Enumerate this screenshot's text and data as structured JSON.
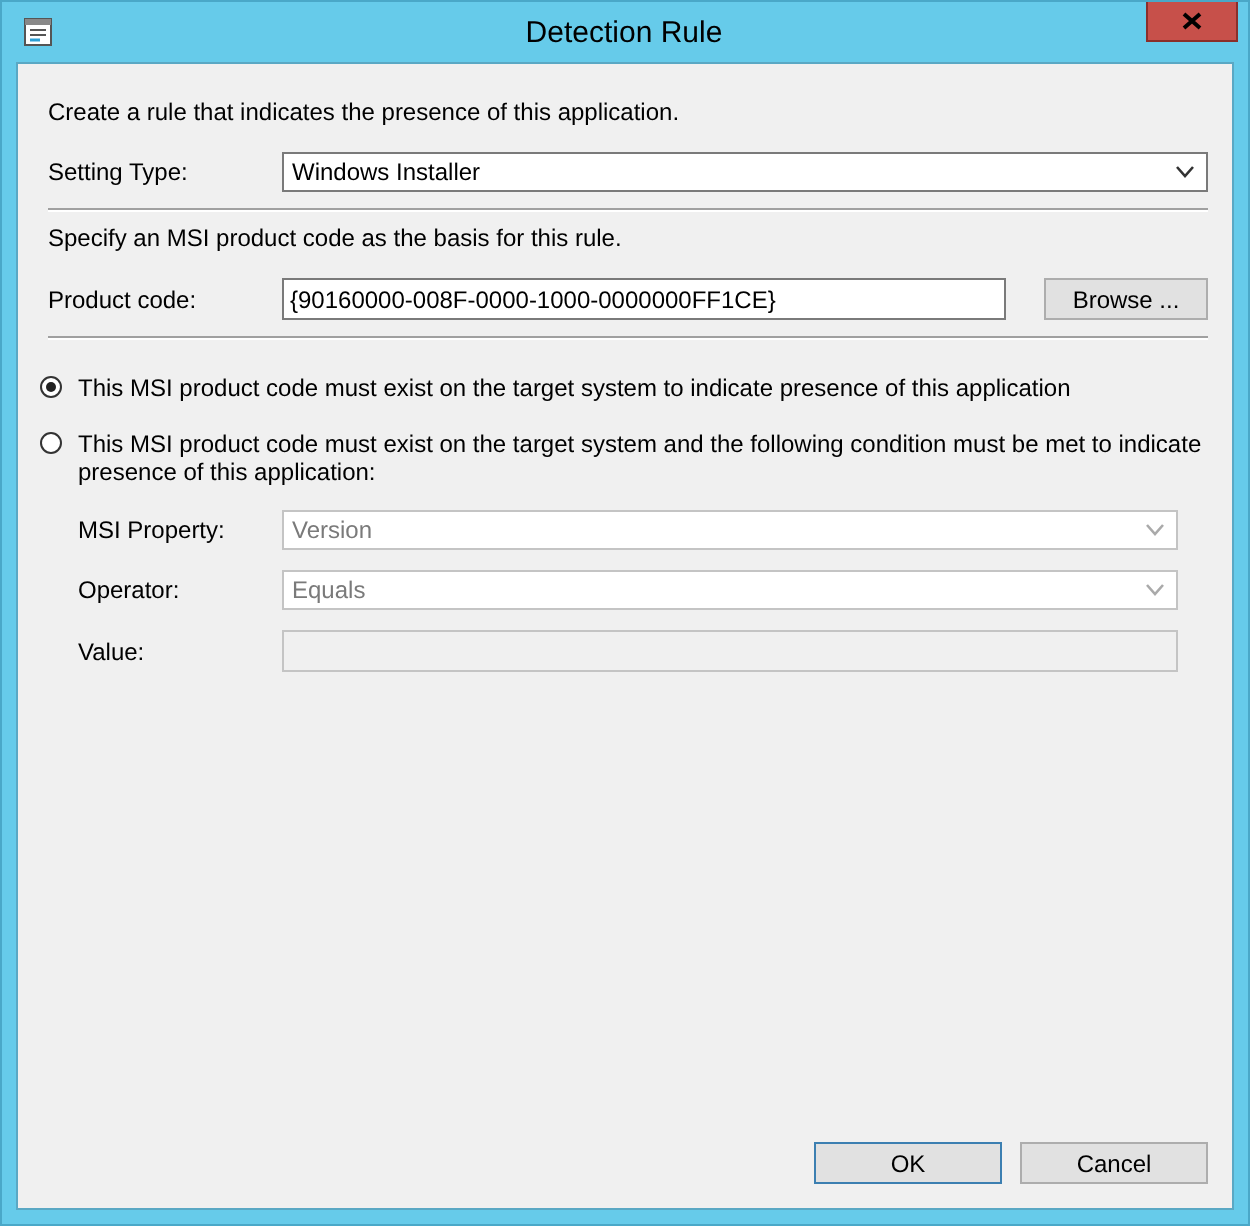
{
  "window": {
    "title": "Detection Rule"
  },
  "intro": "Create a rule that indicates the presence of this application.",
  "setting_type": {
    "label": "Setting Type:",
    "value": "Windows Installer"
  },
  "instruction": "Specify an MSI product code as the basis for this rule.",
  "product_code": {
    "label": "Product code:",
    "value": "{90160000-008F-0000-1000-0000000FF1CE}"
  },
  "browse_button": "Browse ...",
  "options": [
    {
      "label": "This MSI product code must exist on the target system to indicate presence of this application",
      "selected": true
    },
    {
      "label": "This MSI product code must exist on the target system and the following condition must be met to indicate presence of this application:",
      "selected": false
    }
  ],
  "condition": {
    "disabled": true,
    "fields": [
      {
        "kind": "dropdown",
        "label": "MSI Property:",
        "value": "Version"
      },
      {
        "kind": "dropdown",
        "label": "Operator:",
        "value": "Equals"
      },
      {
        "kind": "text",
        "label": "Value:"
      }
    ]
  },
  "buttons": [
    {
      "label": "OK",
      "default": true
    },
    {
      "label": "Cancel",
      "default": false
    }
  ]
}
